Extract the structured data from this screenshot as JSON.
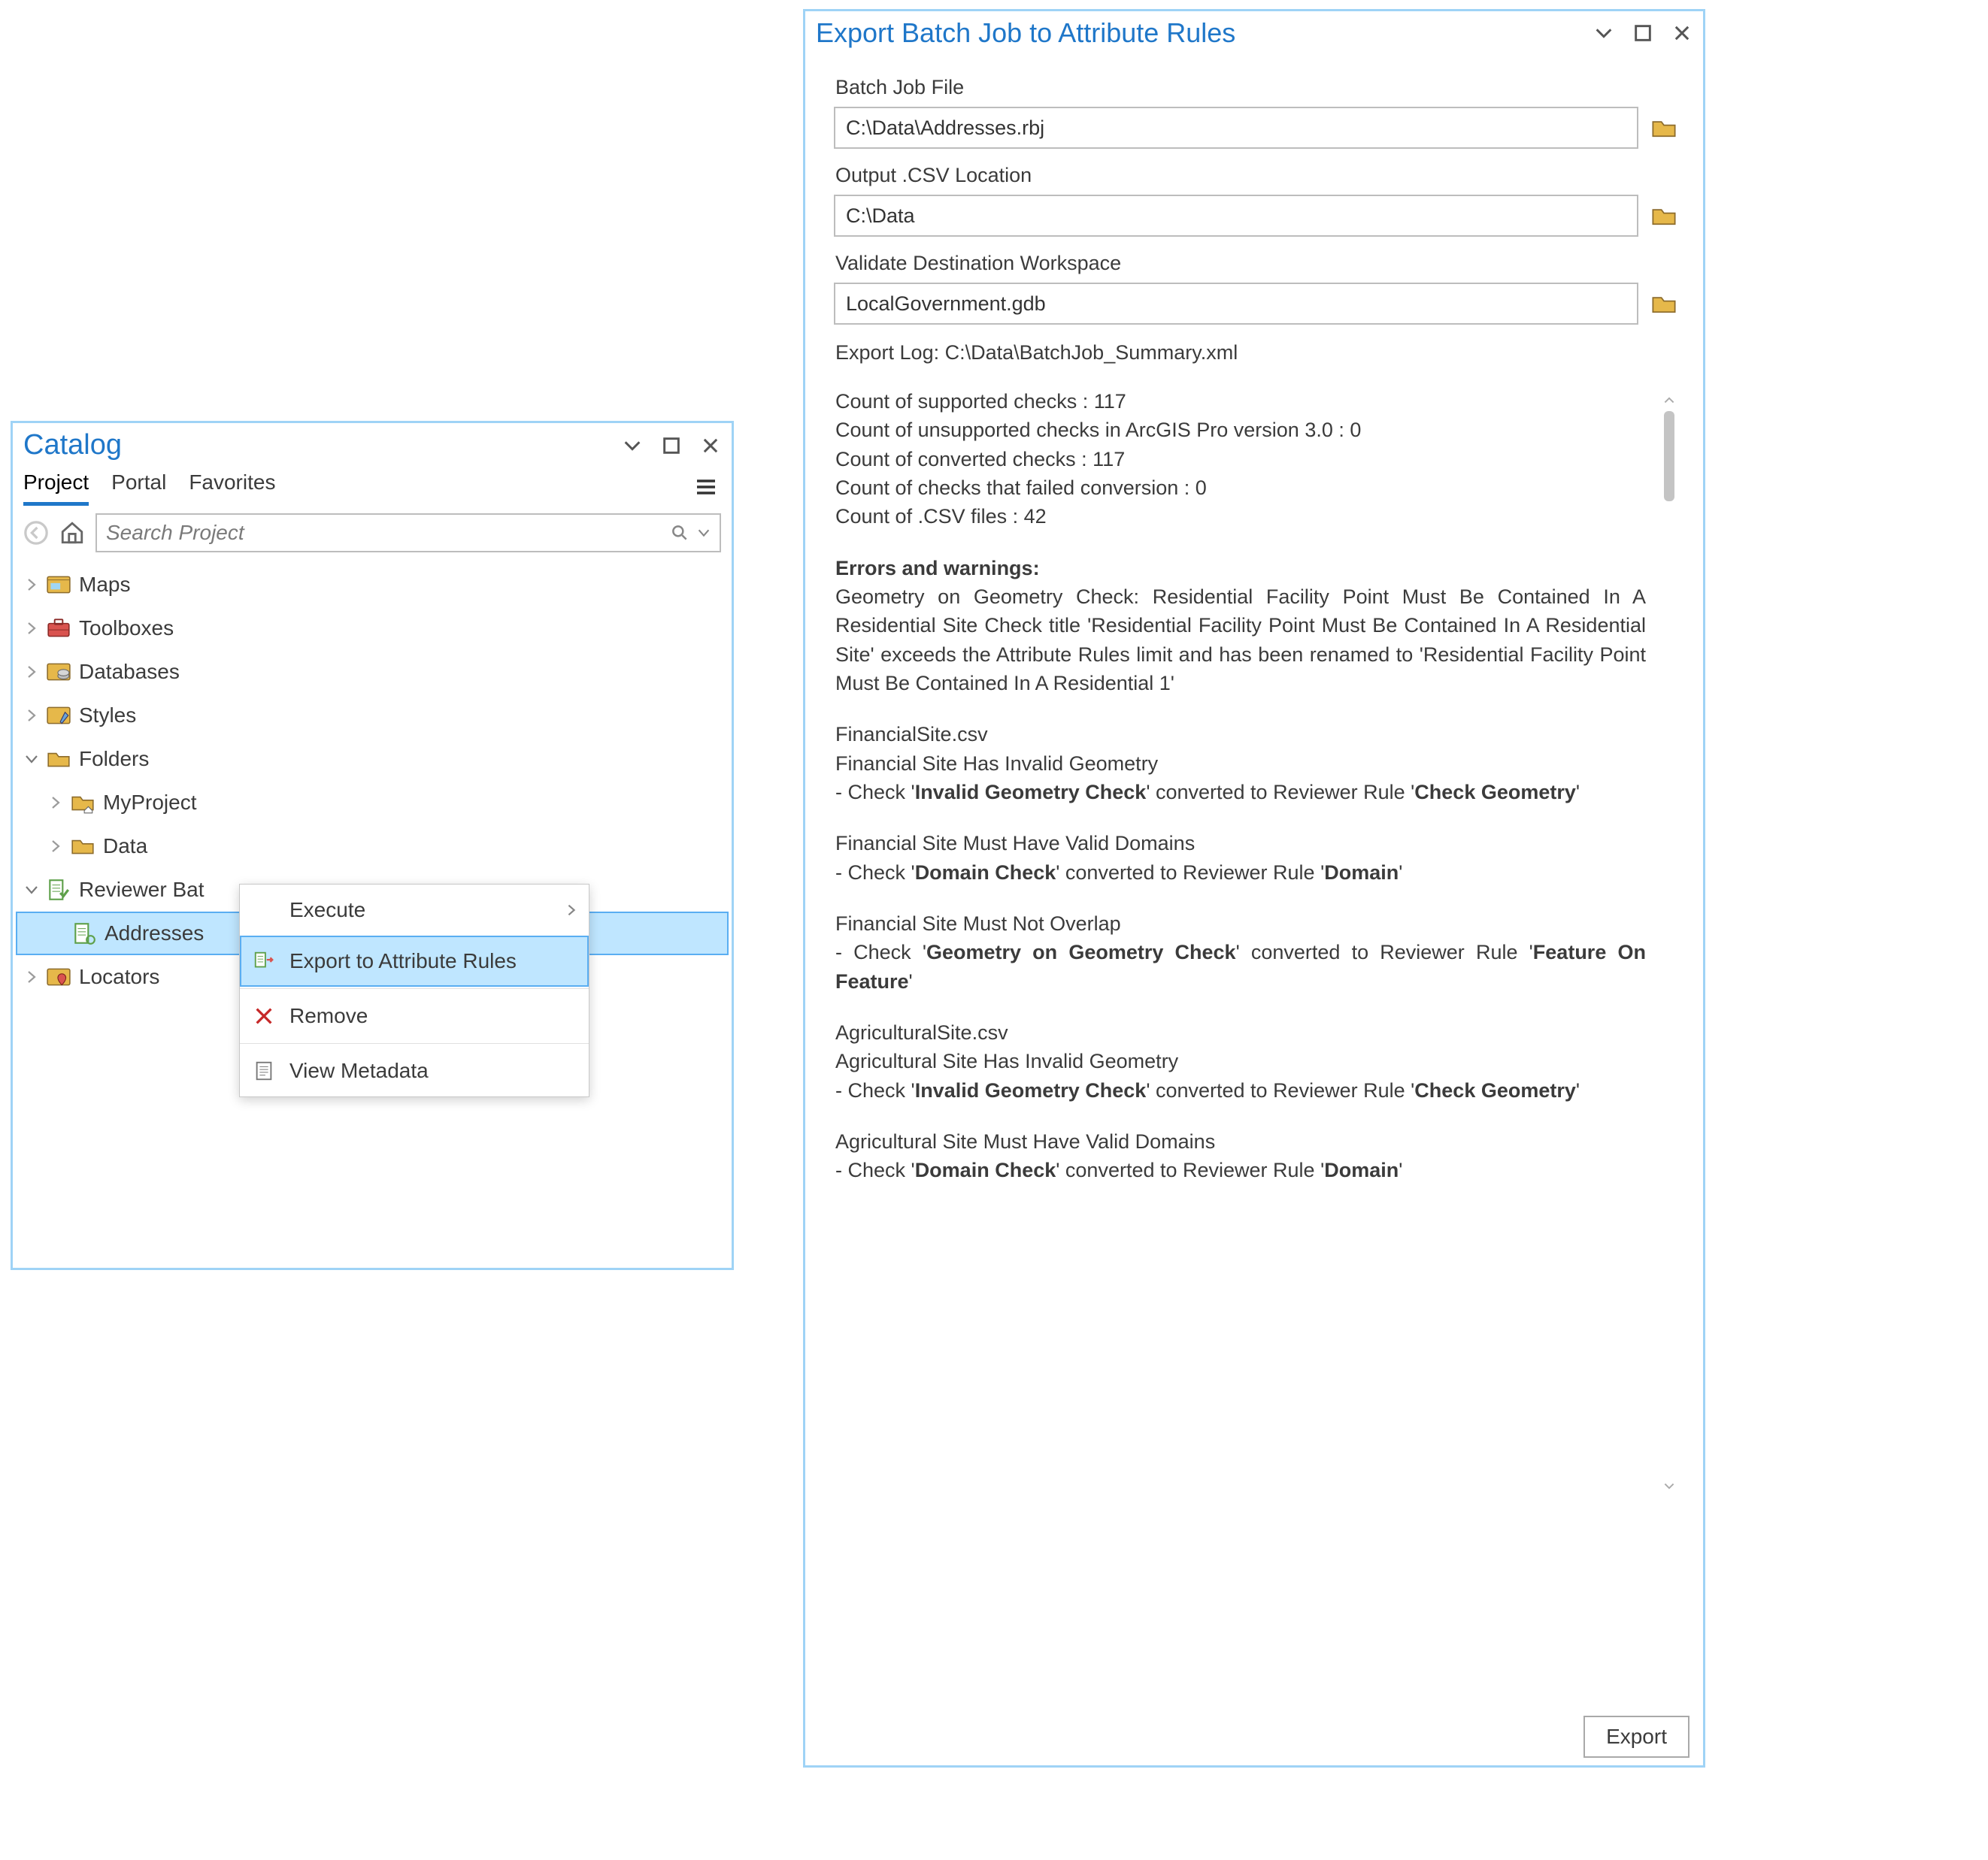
{
  "catalog": {
    "title": "Catalog",
    "tabs": [
      "Project",
      "Portal",
      "Favorites"
    ],
    "active_tab": 0,
    "search_placeholder": "Search Project",
    "tree": [
      {
        "label": "Maps",
        "icon": "maps",
        "expanded": false,
        "level": 0
      },
      {
        "label": "Toolboxes",
        "icon": "toolbox",
        "expanded": false,
        "level": 0
      },
      {
        "label": "Databases",
        "icon": "database",
        "expanded": false,
        "level": 0
      },
      {
        "label": "Styles",
        "icon": "styles",
        "expanded": false,
        "level": 0
      },
      {
        "label": "Folders",
        "icon": "folder",
        "expanded": true,
        "level": 0
      },
      {
        "label": "MyProject",
        "icon": "home-folder",
        "expanded": false,
        "level": 1,
        "parent": 4
      },
      {
        "label": "Data",
        "icon": "folder",
        "expanded": false,
        "level": 1,
        "parent": 4
      },
      {
        "label": "Reviewer Bat",
        "icon": "reviewer",
        "expanded": true,
        "level": 0
      },
      {
        "label": "Addresses",
        "icon": "rules",
        "level": 1,
        "parent": 7,
        "selected": true
      },
      {
        "label": "Locators",
        "icon": "locators",
        "expanded": false,
        "level": 0
      }
    ]
  },
  "context_menu": {
    "items": [
      {
        "label": "Execute",
        "icon": "",
        "has_sub": true
      },
      {
        "label": "Export to Attribute Rules",
        "icon": "export-rules",
        "highlight": true
      },
      {
        "label": "Remove",
        "icon": "remove"
      },
      {
        "label": "View Metadata",
        "icon": "metadata"
      }
    ]
  },
  "export": {
    "title": "Export Batch Job to Attribute Rules",
    "fields": {
      "batch_job_label": "Batch Job File",
      "batch_job_value": "C:\\Data\\Addresses.rbj",
      "csv_label": "Output .CSV Location",
      "csv_value": "C:\\Data",
      "workspace_label": "Validate Destination Workspace",
      "workspace_value": "LocalGovernment.gdb"
    },
    "export_log_label": "Export Log: C:\\Data\\BatchJob_Summary.xml",
    "summary": {
      "supported": "Count of supported checks : 117",
      "unsupported": "Count of unsupported checks in ArcGIS Pro version 3.0 : 0",
      "converted": "Count of converted checks : 117",
      "failed": "Count of checks that failed conversion : 0",
      "csv_files": "Count of .CSV files : 42"
    },
    "errors_heading": "Errors and warnings:",
    "geom_warning_pre": "Geometry on Geometry Check: Residential Facility Point Must Be Contained In A Residential Site Check title 'Residential Facility Point Must Be Contained In A Residential Site' exceeds the Attribute Rules limit and has been renamed to 'Residential Facility Point Must Be Contained In A Residential 1'",
    "sections": {
      "fs_file": "FinancialSite.csv",
      "fs_r1_title": "Financial Site Has Invalid Geometry",
      "fs_r1_pre": " - Check '",
      "fs_r1_b1": "Invalid Geometry Check",
      "fs_r1_mid": "' converted to Reviewer Rule '",
      "fs_r1_b2": "Check Geometry",
      "fs_r1_post": "'",
      "fs_r2_title": "Financial Site Must Have Valid Domains",
      "fs_r2_pre": " - Check '",
      "fs_r2_b1": "Domain Check",
      "fs_r2_mid": "' converted to Reviewer Rule '",
      "fs_r2_b2": "Domain",
      "fs_r2_post": "'",
      "fs_r3_title": "Financial Site Must Not Overlap",
      "fs_r3_pre": " - Check '",
      "fs_r3_b1": "Geometry on Geometry Check",
      "fs_r3_mid": "' converted to Reviewer Rule '",
      "fs_r3_b2": "Feature On Feature",
      "fs_r3_post": "'",
      "ag_file": "AgriculturalSite.csv",
      "ag_r1_title": "Agricultural Site Has Invalid Geometry",
      "ag_r1_pre": " - Check '",
      "ag_r1_b1": "Invalid Geometry Check",
      "ag_r1_mid": "' converted to Reviewer Rule '",
      "ag_r1_b2": "Check Geometry",
      "ag_r1_post": "'",
      "ag_r2_title": "Agricultural Site Must Have Valid Domains",
      "ag_r2_pre": " - Check '",
      "ag_r2_b1": "Domain Check",
      "ag_r2_mid": "' converted to Reviewer Rule '",
      "ag_r2_b2": "Domain",
      "ag_r2_post": "'"
    },
    "button": "Export"
  }
}
